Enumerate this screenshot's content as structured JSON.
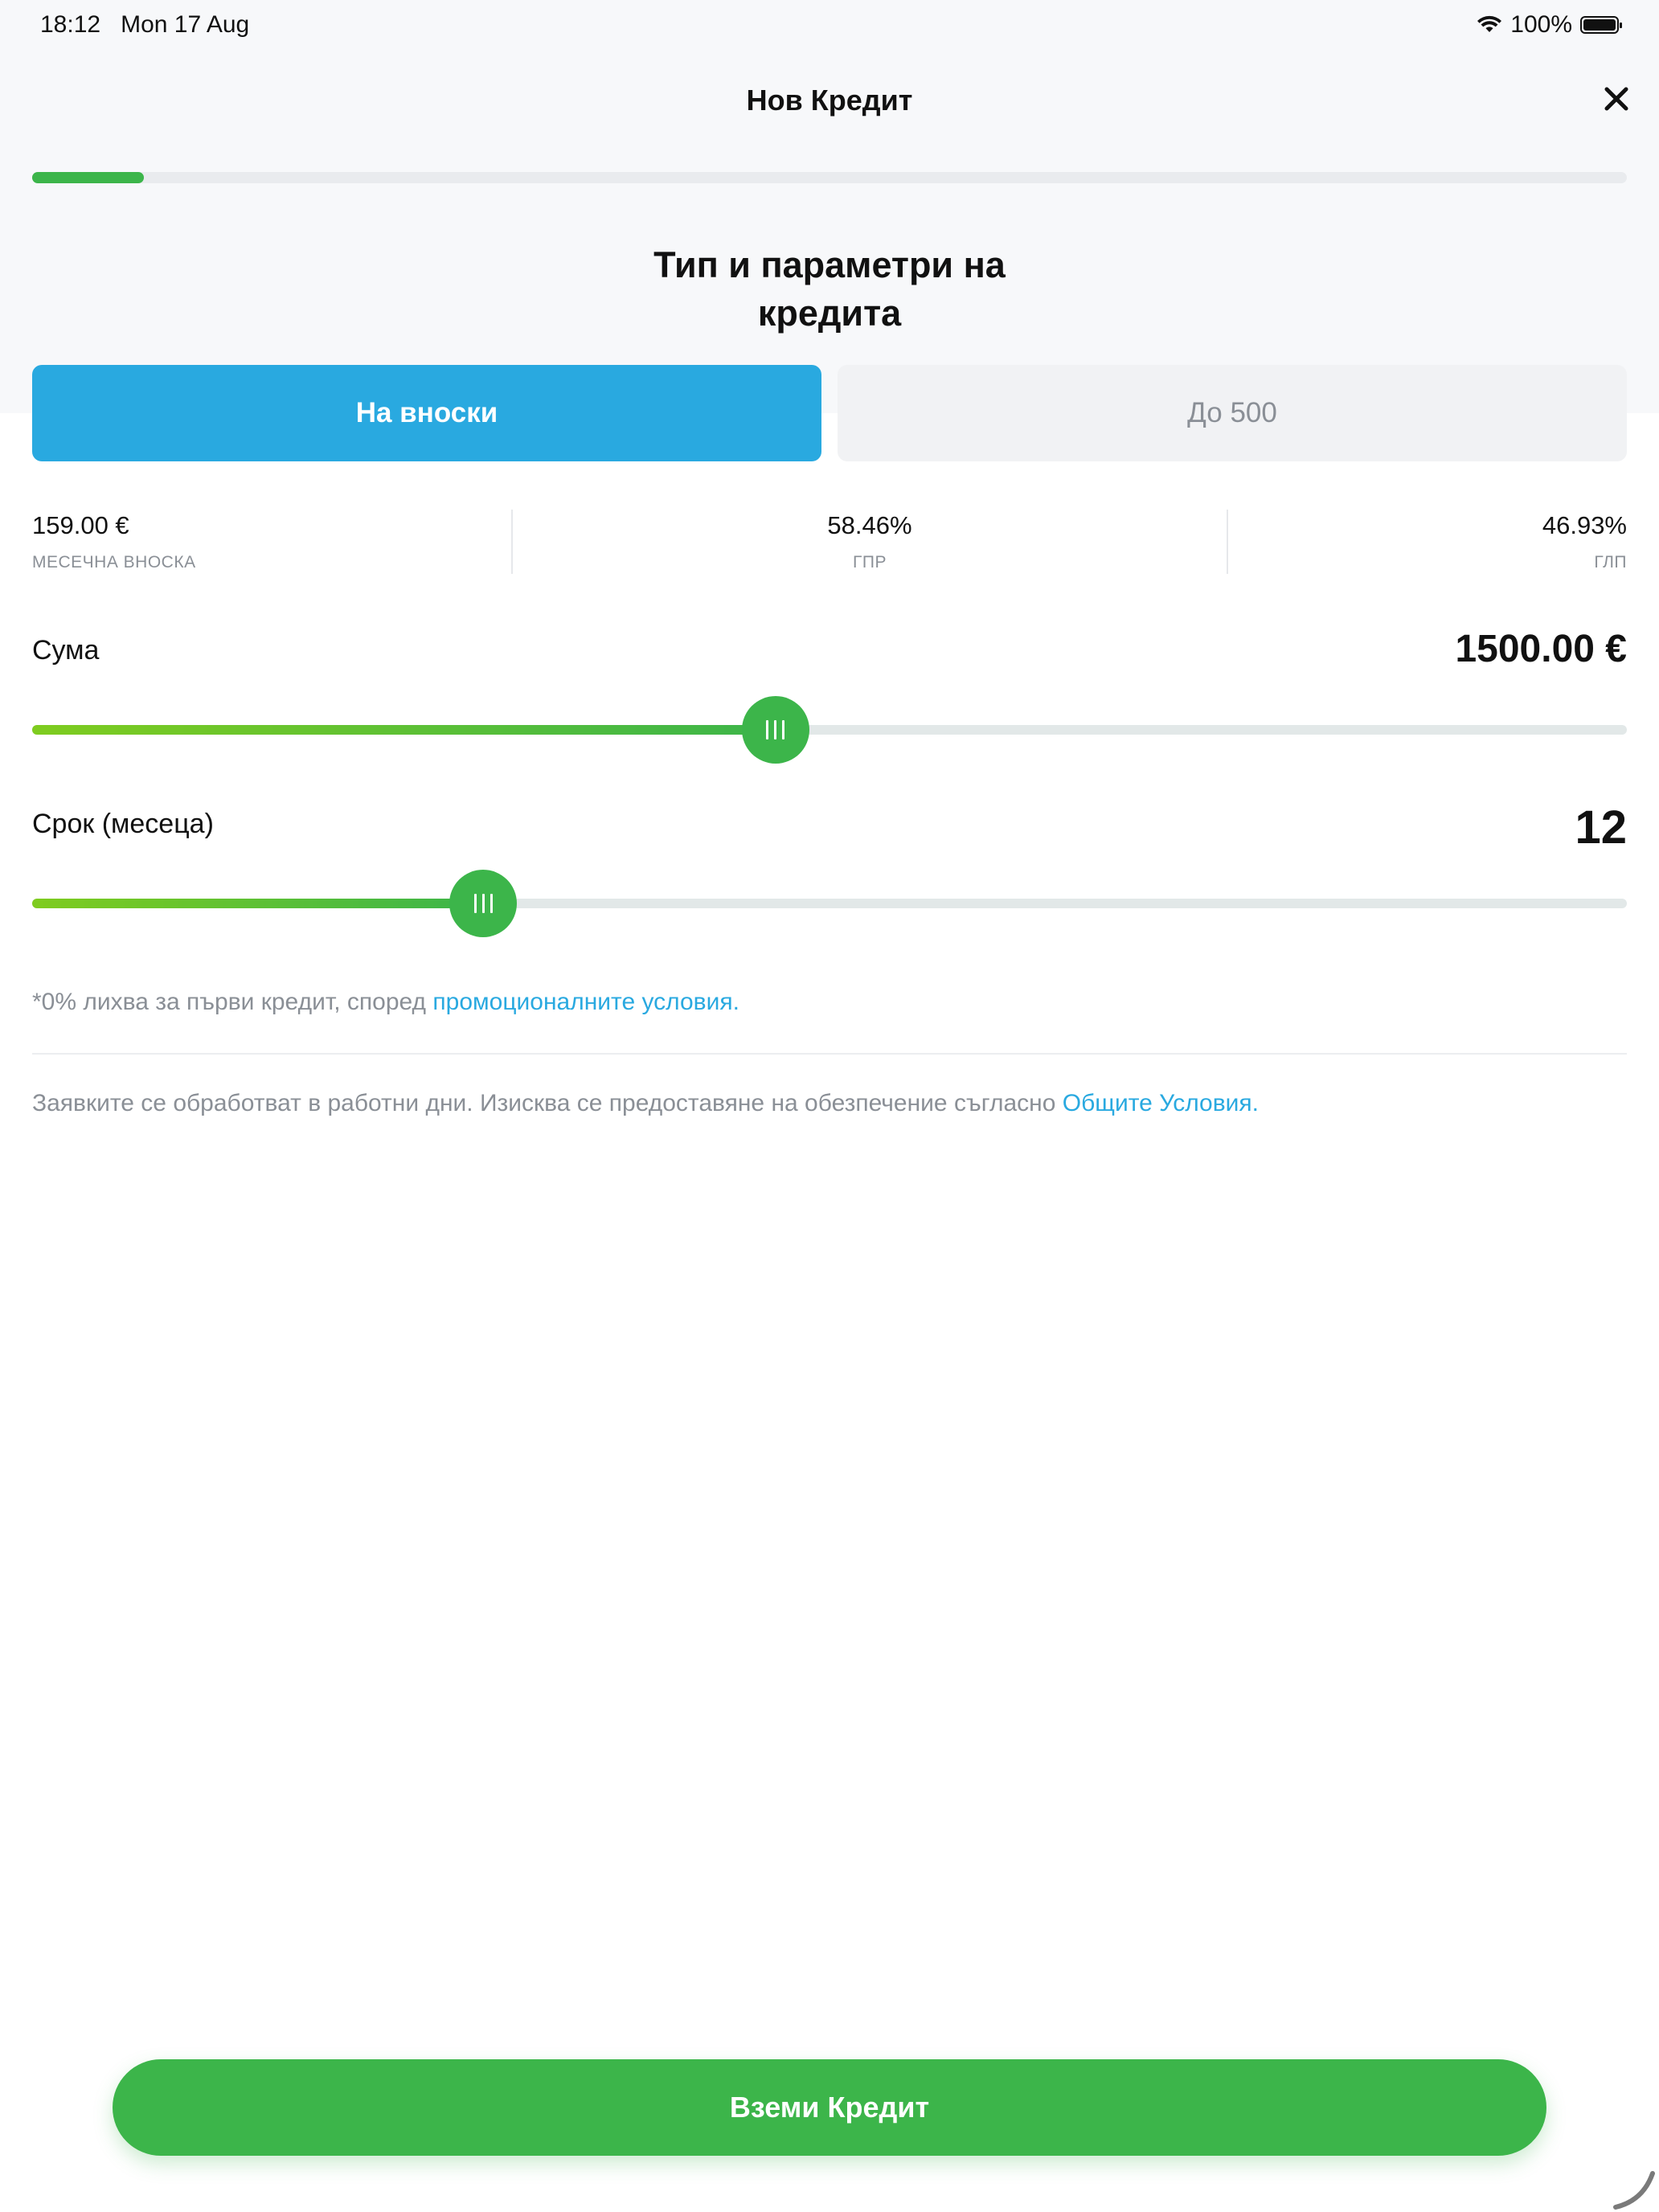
{
  "status_bar": {
    "time": "18:12",
    "date": "Mon 17 Aug",
    "battery": "100%"
  },
  "header": {
    "title": "Нов Кредит",
    "close_icon": "close-icon"
  },
  "progress": {
    "fraction": 0.07,
    "color": "#3cb54a"
  },
  "section": {
    "title_line1": "Тип и параметри на",
    "title_line2": "кредита"
  },
  "tabs": [
    {
      "label": "На вноски",
      "active": true
    },
    {
      "label": "До 500",
      "active": false
    }
  ],
  "stats": {
    "monthly": {
      "value": "159.00 €",
      "label": "МЕСЕЧНА ВНОСКА"
    },
    "gpr": {
      "value": "58.46%",
      "label": "ГПР"
    },
    "glp": {
      "value": "46.93%",
      "label": "ГЛП"
    }
  },
  "sliders": {
    "amount": {
      "label": "Сума",
      "value": "1500.00 €",
      "fraction": 0.466
    },
    "term": {
      "label": "Срок (месеца)",
      "value": "12",
      "fraction": 0.283
    }
  },
  "notes": {
    "promo_text": "*0% лихва за първи кредит, според ",
    "promo_link": "промоционалните условия",
    "promo_end": ".",
    "processing_text": "Заявките се обработват в работни дни. Изисква се предоставяне на обезпечение съгласно ",
    "processing_link": "Общите Условия",
    "processing_end": "."
  },
  "cta": {
    "label": "Вземи Кредит"
  },
  "colors": {
    "accent_blue": "#29a9e0",
    "accent_green": "#3cb54a",
    "light_green": "#7fcc1f",
    "muted_text": "#8a8f96"
  },
  "icons": {
    "wifi": "wifi-icon",
    "battery": "battery-icon",
    "close": "close-icon",
    "grip": "grip-icon"
  }
}
